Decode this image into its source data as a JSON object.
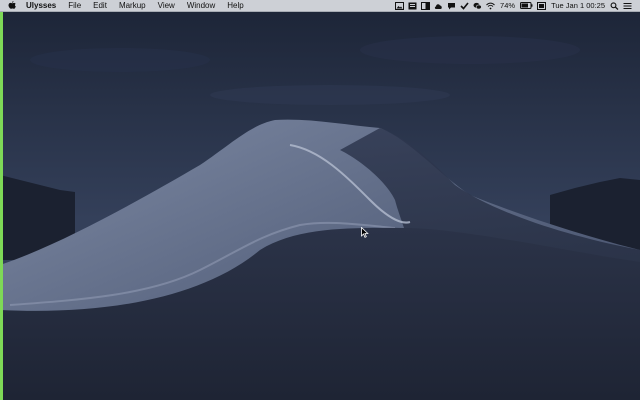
{
  "menubar": {
    "app_name": "Ulysses",
    "menus": [
      "File",
      "Edit",
      "Markup",
      "View",
      "Window",
      "Help"
    ],
    "battery_percent": "74%",
    "datetime": "Tue Jan 1  00:25"
  },
  "icons": {
    "apple": "apple-logo-icon",
    "status": [
      "photo-icon",
      "document-icon",
      "folder-icon",
      "cloud-icon",
      "chat-icon",
      "check-icon",
      "wechat-icon",
      "wifi-icon",
      "battery-icon",
      "keyboard-icon",
      "search-icon",
      "list-icon"
    ]
  },
  "desktop": {
    "wallpaper": "mojave-dark-dune"
  },
  "colors": {
    "menubar_bg": "#cdd0d6",
    "left_strip": "#7ed957",
    "sky_top": "#1f2739",
    "sky_bottom": "#3b4560"
  }
}
